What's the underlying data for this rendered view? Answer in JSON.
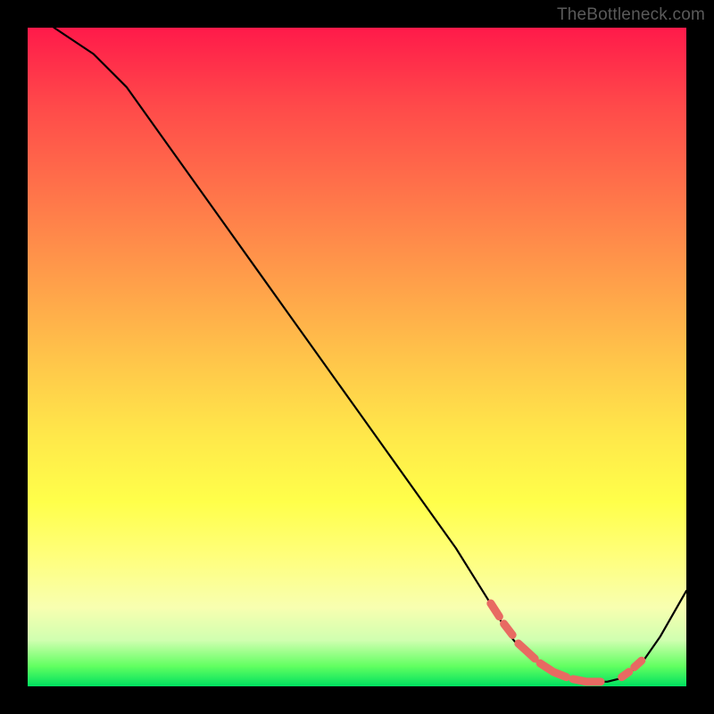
{
  "watermark": "TheBottleneck.com",
  "chart_data": {
    "type": "line",
    "title": "",
    "xlabel": "",
    "ylabel": "",
    "xlim": [
      0,
      100
    ],
    "ylim": [
      0,
      100
    ],
    "series": [
      {
        "name": "curve",
        "x": [
          4,
          10,
          15,
          20,
          25,
          30,
          35,
          40,
          45,
          50,
          55,
          60,
          65,
          70,
          73,
          75,
          78,
          80,
          83,
          85,
          88,
          90,
          93,
          96,
          100
        ],
        "y": [
          100,
          96,
          91,
          84,
          77,
          70,
          63,
          56,
          49,
          42,
          35,
          28,
          21,
          13,
          8,
          5.5,
          3.2,
          2.0,
          1.1,
          0.7,
          0.7,
          1.2,
          3.2,
          7.5,
          14.5
        ]
      }
    ],
    "dotted_segments": [
      {
        "x": [
          70.3,
          71.6
        ],
        "y": [
          12.6,
          10.6
        ]
      },
      {
        "x": [
          72.3,
          73.6
        ],
        "y": [
          9.5,
          7.8
        ]
      },
      {
        "x": [
          74.5,
          75.6,
          77.0
        ],
        "y": [
          6.5,
          5.5,
          4.2
        ]
      },
      {
        "x": [
          77.8,
          79.8,
          81.8
        ],
        "y": [
          3.5,
          2.2,
          1.4
        ]
      },
      {
        "x": [
          82.8,
          84.8,
          87.0
        ],
        "y": [
          1.1,
          0.7,
          0.7
        ]
      },
      {
        "x": [
          90.2,
          91.3
        ],
        "y": [
          1.4,
          2.2
        ]
      },
      {
        "x": [
          92.1,
          93.2
        ],
        "y": [
          2.9,
          3.9
        ]
      }
    ]
  }
}
